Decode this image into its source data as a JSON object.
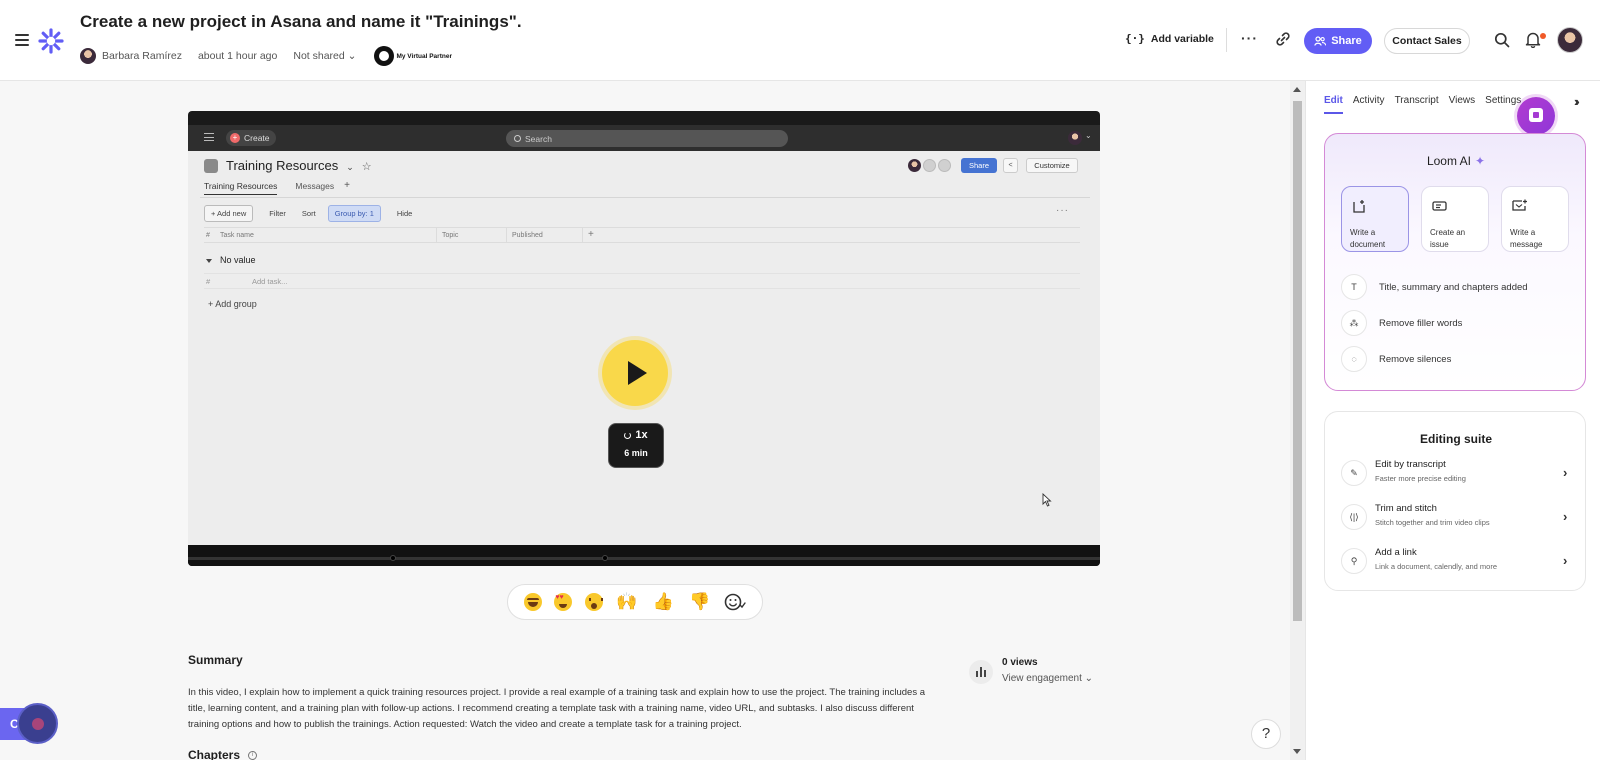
{
  "header": {
    "title": "Create a new project in Asana and name it \"Trainings\".",
    "author": "Barbara Ramírez",
    "time": "about 1 hour ago",
    "sharing": "Not shared",
    "partner_logo_text": "My Virtual Partner",
    "add_variable": "Add variable",
    "add_variable_icon": "{·}",
    "share_label": "Share",
    "contact_sales": "Contact Sales",
    "icons": [
      "menu-icon",
      "loom-logo-icon",
      "link-icon",
      "search-icon",
      "bell-icon"
    ]
  },
  "video": {
    "app": {
      "create_label": "Create",
      "search_placeholder": "Search",
      "project_title": "Training Resources",
      "share_label": "Share",
      "customize_label": "Customize",
      "tabs": [
        "Training Resources",
        "Messages"
      ],
      "toolbar": {
        "add_new": "+ Add new",
        "filter": "Filter",
        "sort": "Sort",
        "group_by": "Group by: 1",
        "hide": "Hide"
      },
      "columns": [
        "Task name",
        "Topic",
        "Published"
      ],
      "group_name": "No value",
      "add_task": "Add task...",
      "add_group": "Add group"
    },
    "speed": "1x",
    "duration": "6 min"
  },
  "reactions": [
    "😂",
    "😍",
    "😮",
    "🙌",
    "👍",
    "👎",
    "add-reaction-icon"
  ],
  "summary": {
    "heading": "Summary",
    "text": "In this video, I explain how to implement a quick training resources project. I provide a real example of a training task and explain how to use the project. The training includes a title, learning content, and a training plan with follow-up actions. I recommend creating a template task with a training name, video URL, and subtasks. I also discuss different training options and how to publish the trainings. Action requested: Watch the video and create a template task for a training project."
  },
  "chapters_heading": "Chapters",
  "stats": {
    "views": "0 views",
    "view_engagement": "View engagement"
  },
  "help_label": "?",
  "right_panel": {
    "tabs": [
      "Edit",
      "Activity",
      "Transcript",
      "Views",
      "Settings"
    ],
    "active_tab": "Edit",
    "loom_ai": {
      "title": "Loom AI",
      "buttons": [
        "Write a document",
        "Create an issue",
        "Write a message"
      ],
      "rows": [
        "Title, summary and chapters added",
        "Remove filler words",
        "Remove silences"
      ]
    },
    "editing_suite": {
      "title": "Editing suite",
      "items": [
        {
          "title": "Edit by transcript",
          "subtitle": "Faster more precise editing"
        },
        {
          "title": "Trim and stitch",
          "subtitle": "Stitch together and trim video clips"
        },
        {
          "title": "Add a link",
          "subtitle": "Link a document, calendly, and more"
        }
      ]
    }
  },
  "colors": {
    "accent": "#625df5",
    "play_button": "#f9d84a",
    "ai_border": "#d48ad6"
  }
}
